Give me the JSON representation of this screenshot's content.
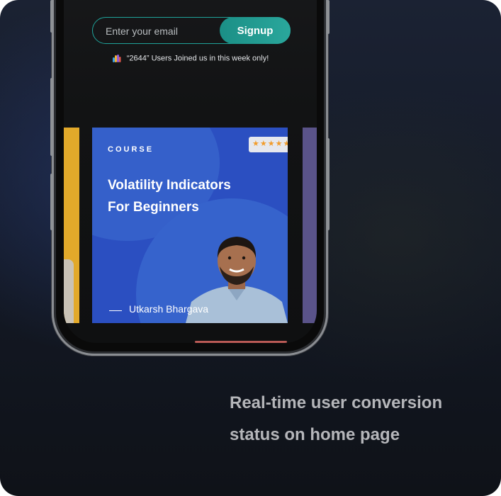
{
  "signup": {
    "email_placeholder": "Enter your email",
    "button_label": "Signup"
  },
  "status": {
    "joined_text": "“2644” Users Joined us in this week only!"
  },
  "course_card": {
    "category": "COURSE",
    "title_line1": "Volatility Indicators",
    "title_line2": "For Beginners",
    "rating_stars": 5,
    "rating_display": "★★★★★",
    "instructor": "Utkarsh Bhargava"
  },
  "caption": {
    "line1": "Real-time user conversion",
    "line2": "status on home page"
  },
  "colors": {
    "accent_teal": "#1fa39a",
    "course_blue": "#2b4fc1",
    "star_orange": "#f19c2b",
    "left_card_yellow": "#e2a92a",
    "right_card_purple": "#5a5389"
  }
}
